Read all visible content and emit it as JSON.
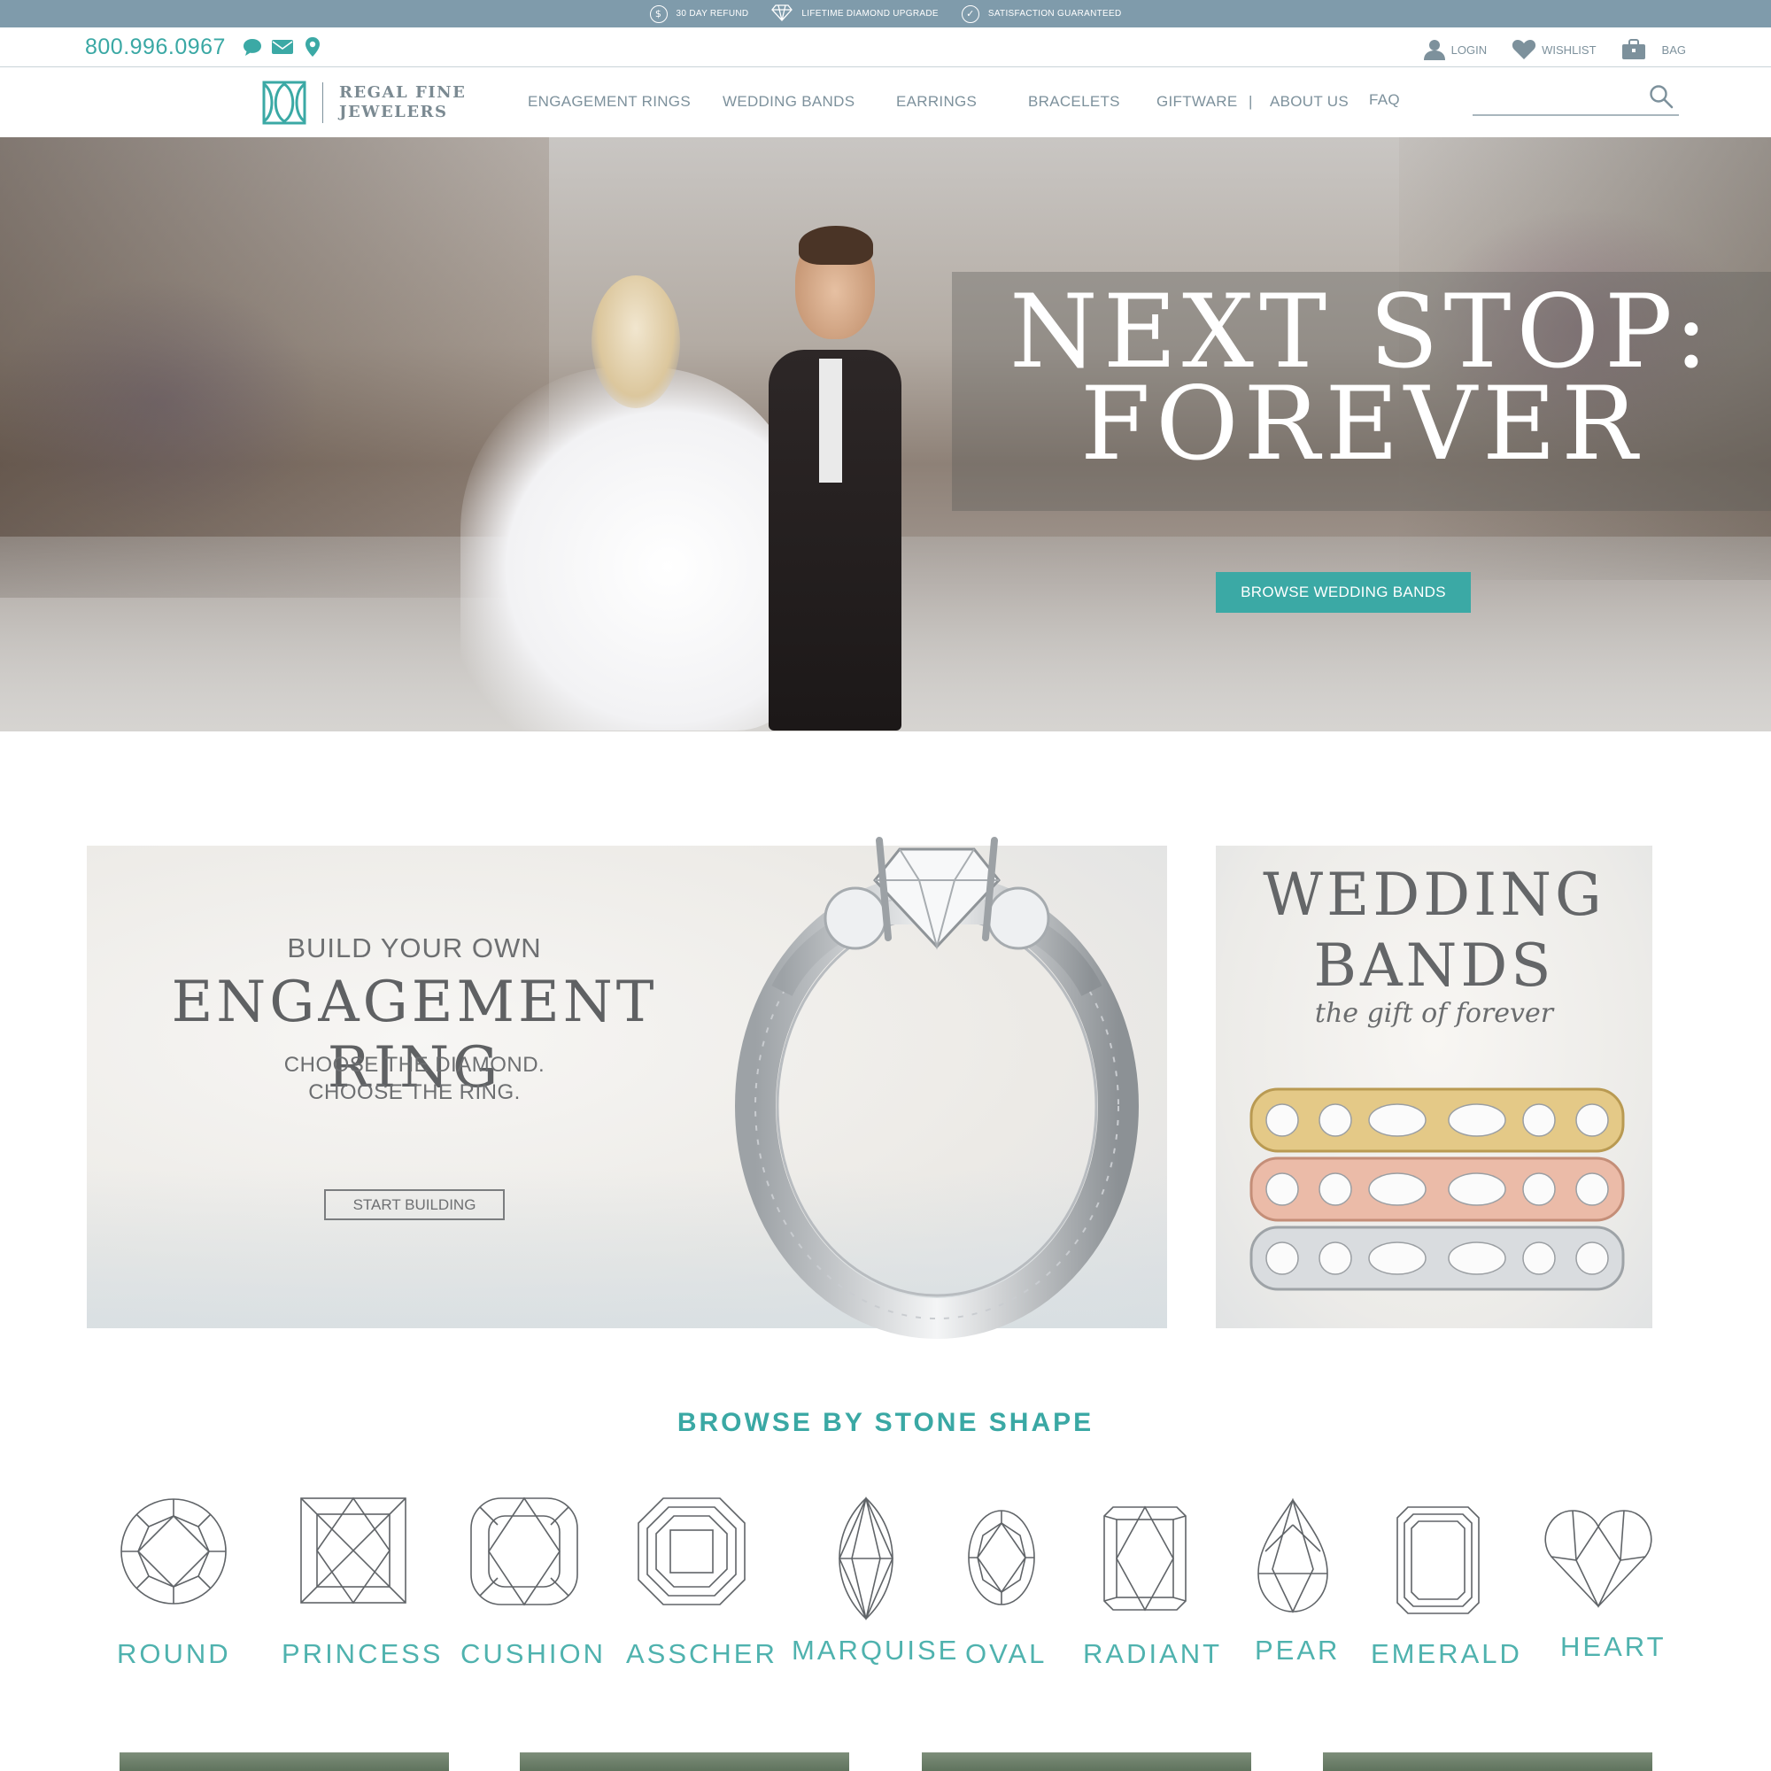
{
  "promo_bar": {
    "items": [
      {
        "icon": "dollar-icon",
        "label": "30 DAY REFUND"
      },
      {
        "icon": "diamond-icon",
        "label": "LIFETIME DIAMOND UPGRADE"
      },
      {
        "icon": "seal-icon",
        "label": "SATISFACTION GUARANTEED"
      }
    ]
  },
  "contact": {
    "phone": "800.996.0967",
    "icons": [
      "chat-icon",
      "mail-icon",
      "location-pin-icon"
    ]
  },
  "account": {
    "login": "LOGIN",
    "wishlist": "WISHLIST",
    "bag": "BAG"
  },
  "brand": {
    "line1": "REGAL FINE",
    "line2": "JEWELERS",
    "accent_color": "#3ba9a5"
  },
  "nav": {
    "items": [
      "ENGAGEMENT RINGS",
      "WEDDING BANDS",
      "EARRINGS",
      "BRACELETS",
      "GIFTWARE",
      "ABOUT US",
      "FAQ"
    ],
    "separator": "|"
  },
  "search": {
    "value": "",
    "placeholder": ""
  },
  "hero": {
    "title_line1": "NEXT STOP:",
    "title_line2": "FOREVER",
    "cta": "BROWSE WEDDING BANDS"
  },
  "engagement_tile": {
    "eyebrow": "BUILD YOUR OWN",
    "heading": "ENGAGEMENT RING",
    "sub_line1": "CHOOSE THE DIAMOND.",
    "sub_line2": "CHOOSE THE RING.",
    "button": "START BUILDING"
  },
  "wedding_tile": {
    "title_line1": "WEDDING",
    "title_line2": "BANDS",
    "subtitle": "the gift of forever"
  },
  "stone_shapes": {
    "title": "BROWSE BY STONE SHAPE",
    "items": [
      {
        "label": "ROUND",
        "icon": "round-diamond-icon"
      },
      {
        "label": "PRINCESS",
        "icon": "princess-diamond-icon"
      },
      {
        "label": "CUSHION",
        "icon": "cushion-diamond-icon"
      },
      {
        "label": "ASSCHER",
        "icon": "asscher-diamond-icon"
      },
      {
        "label": "MARQUISE",
        "icon": "marquise-diamond-icon"
      },
      {
        "label": "OVAL",
        "icon": "oval-diamond-icon"
      },
      {
        "label": "RADIANT",
        "icon": "radiant-diamond-icon"
      },
      {
        "label": "PEAR",
        "icon": "pear-diamond-icon"
      },
      {
        "label": "EMERALD",
        "icon": "emerald-diamond-icon"
      },
      {
        "label": "HEART",
        "icon": "heart-diamond-icon"
      }
    ]
  }
}
